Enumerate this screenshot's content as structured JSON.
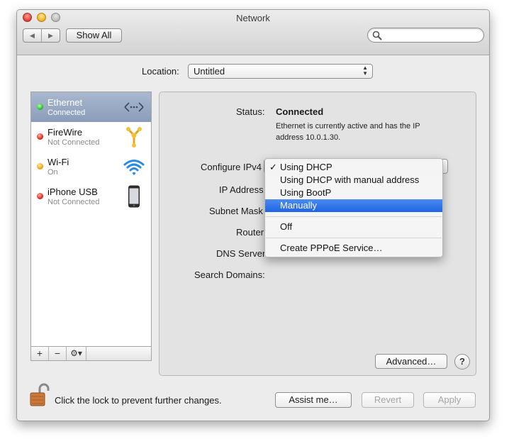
{
  "window": {
    "title": "Network"
  },
  "toolbar": {
    "back": "◀",
    "forward": "▶",
    "show_all": "Show All",
    "search_placeholder": ""
  },
  "location": {
    "label": "Location:",
    "value": "Untitled"
  },
  "services": [
    {
      "name": "Ethernet",
      "status": "Connected",
      "color": "green",
      "selected": true,
      "icon": "ethernet-icon"
    },
    {
      "name": "FireWire",
      "status": "Not Connected",
      "color": "red",
      "selected": false,
      "icon": "firewire-icon"
    },
    {
      "name": "Wi-Fi",
      "status": "On",
      "color": "yellow",
      "selected": false,
      "icon": "wifi-icon"
    },
    {
      "name": "iPhone USB",
      "status": "Not Connected",
      "color": "red",
      "selected": false,
      "icon": "iphone-icon"
    }
  ],
  "sidebar_bar": {
    "add": "+",
    "remove": "−",
    "gear": "⚙▾"
  },
  "detail": {
    "status_label": "Status:",
    "status_value": "Connected",
    "status_desc": "Ethernet is currently active and has the IP address 10.0.1.30.",
    "configure_label": "Configure IPv4",
    "ip_label": "IP Address",
    "subnet_label": "Subnet Mask",
    "router_label": "Router",
    "dns_label": "DNS Server",
    "search_domains_label": "Search Domains:",
    "advanced": "Advanced…",
    "help": "?"
  },
  "ipv4_menu": {
    "items": [
      "Using DHCP",
      "Using DHCP with manual address",
      "Using BootP",
      "Manually"
    ],
    "checked": "✓",
    "selected_item": "Using DHCP",
    "highlighted_item": "Manually",
    "off": "Off",
    "pppoe": "Create PPPoE Service…"
  },
  "footer": {
    "lock_text": "Click the lock to prevent further changes.",
    "assist": "Assist me…",
    "revert": "Revert",
    "apply": "Apply"
  },
  "colors": {
    "selection": "#8a9cb9",
    "menu_highlight": "#1f63e4",
    "status_connected": "#2fbf2f",
    "status_off": "#e02b20",
    "status_partial": "#f1a516"
  }
}
